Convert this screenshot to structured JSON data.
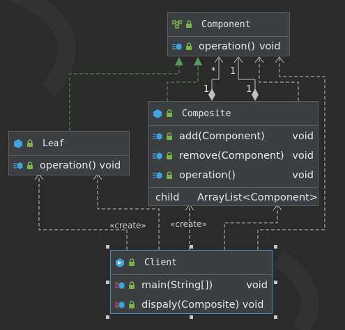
{
  "component": {
    "name": "Component",
    "members": [
      {
        "name": "operation()",
        "type": "void"
      }
    ]
  },
  "composite": {
    "name": "Composite",
    "members": [
      {
        "name": "add(Component)",
        "type": "void"
      },
      {
        "name": "remove(Component)",
        "type": "void"
      },
      {
        "name": "operation()",
        "type": "void"
      }
    ],
    "fields": [
      {
        "name": "child",
        "type": "ArrayList<Component>"
      }
    ]
  },
  "leaf": {
    "name": "Leaf",
    "members": [
      {
        "name": "operation() void"
      }
    ]
  },
  "client": {
    "name": "Client",
    "members": [
      {
        "name": "main(String[])",
        "type": "void"
      },
      {
        "name": "dispaly(Composite) void"
      }
    ]
  },
  "edge_labels": {
    "create_left": "«create»",
    "create_right": "«create»",
    "mult_star": "*",
    "mult_one_a": "1",
    "mult_one_b": "1",
    "mult_one_c": "1"
  },
  "colors": {
    "inherit": "#5a9a5a",
    "dependency": "#c0c0c0",
    "class_icon": "#3fa3e0",
    "lock": "#79b548",
    "selection": "#4a88c7"
  }
}
